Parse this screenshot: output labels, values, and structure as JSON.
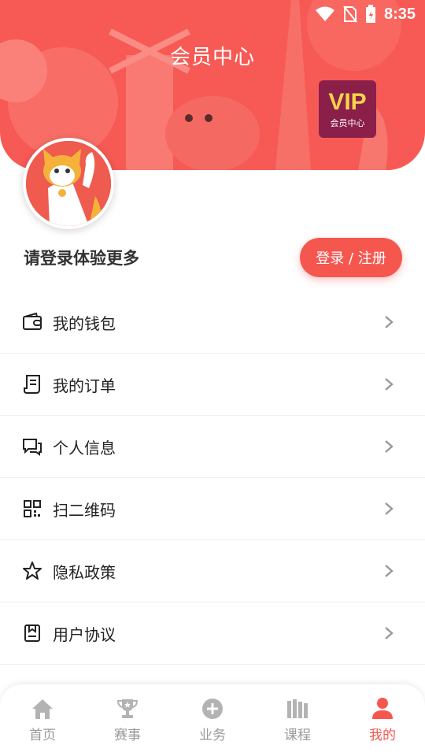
{
  "status_bar": {
    "time": "8:35"
  },
  "header": {
    "title": "会员中心"
  },
  "vip_badge": {
    "label": "VIP",
    "sub_label": "会员中心"
  },
  "profile": {
    "login_prompt": "请登录体验更多",
    "login_button": "登录 / 注册"
  },
  "menu": {
    "items": [
      {
        "label": "我的钱包",
        "icon": "wallet-icon"
      },
      {
        "label": "我的订单",
        "icon": "order-icon"
      },
      {
        "label": "个人信息",
        "icon": "chat-icon"
      },
      {
        "label": "扫二维码",
        "icon": "qrcode-icon"
      },
      {
        "label": "隐私政策",
        "icon": "star-icon"
      },
      {
        "label": "用户协议",
        "icon": "document-icon"
      }
    ]
  },
  "bottom_nav": {
    "items": [
      {
        "label": "首页",
        "icon": "home-icon"
      },
      {
        "label": "赛事",
        "icon": "trophy-icon"
      },
      {
        "label": "业务",
        "icon": "plus-circle-icon"
      },
      {
        "label": "课程",
        "icon": "books-icon"
      },
      {
        "label": "我的",
        "icon": "user-icon",
        "active": true
      }
    ]
  },
  "colors": {
    "accent": "#f5574f",
    "vip_bg": "#8a1f4a",
    "vip_text": "#f6d44a"
  }
}
